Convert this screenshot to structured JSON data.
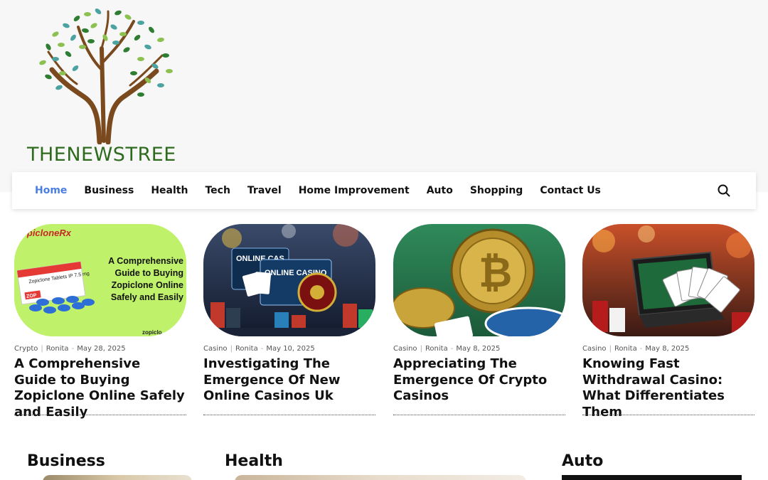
{
  "site": {
    "logo_text": "THENEWSTREE"
  },
  "nav": {
    "items": [
      {
        "label": "Home",
        "active": true
      },
      {
        "label": "Business"
      },
      {
        "label": "Health"
      },
      {
        "label": "Tech"
      },
      {
        "label": "Travel"
      },
      {
        "label": "Home Improvement"
      },
      {
        "label": "Auto"
      },
      {
        "label": "Shopping"
      },
      {
        "label": "Contact Us"
      }
    ],
    "search_icon": "search-icon"
  },
  "posts": [
    {
      "category": "Crypto",
      "author": "Ronita",
      "date": "May 28, 2025",
      "title": "A Comprehensive Guide to Buying Zopiclone Online Safely and Easily",
      "thumb": {
        "brand": "ZopicloneRx",
        "headline": "A Comprehensive Guide to Buying Zopiclone Online Safely and Easily",
        "pack_label": "Zopiclone Tablets IP 7.5 mg",
        "pack_brand": "ZOP",
        "corner": "zopiclo"
      }
    },
    {
      "category": "Casino",
      "author": "Ronita",
      "date": "May 10, 2025",
      "title": "Investigating The Emergence Of New Online Casinos Uk",
      "thumb": {
        "screen1": "ONLINE CAS",
        "screen2": "ONLINE CASINO"
      }
    },
    {
      "category": "Casino",
      "author": "Ronita",
      "date": "May 8, 2025",
      "title": "Appreciating The Emergence Of Crypto Casinos"
    },
    {
      "category": "Casino",
      "author": "Ronita",
      "date": "May 8, 2025",
      "title": "Knowing Fast Withdrawal Casino: What Differentiates Them"
    }
  ],
  "sections": [
    {
      "label": "Business"
    },
    {
      "label": "Health"
    },
    {
      "label": "Auto"
    }
  ],
  "colors": {
    "accent": "#4a7fe0",
    "logo_green": "#2e6b1f"
  }
}
